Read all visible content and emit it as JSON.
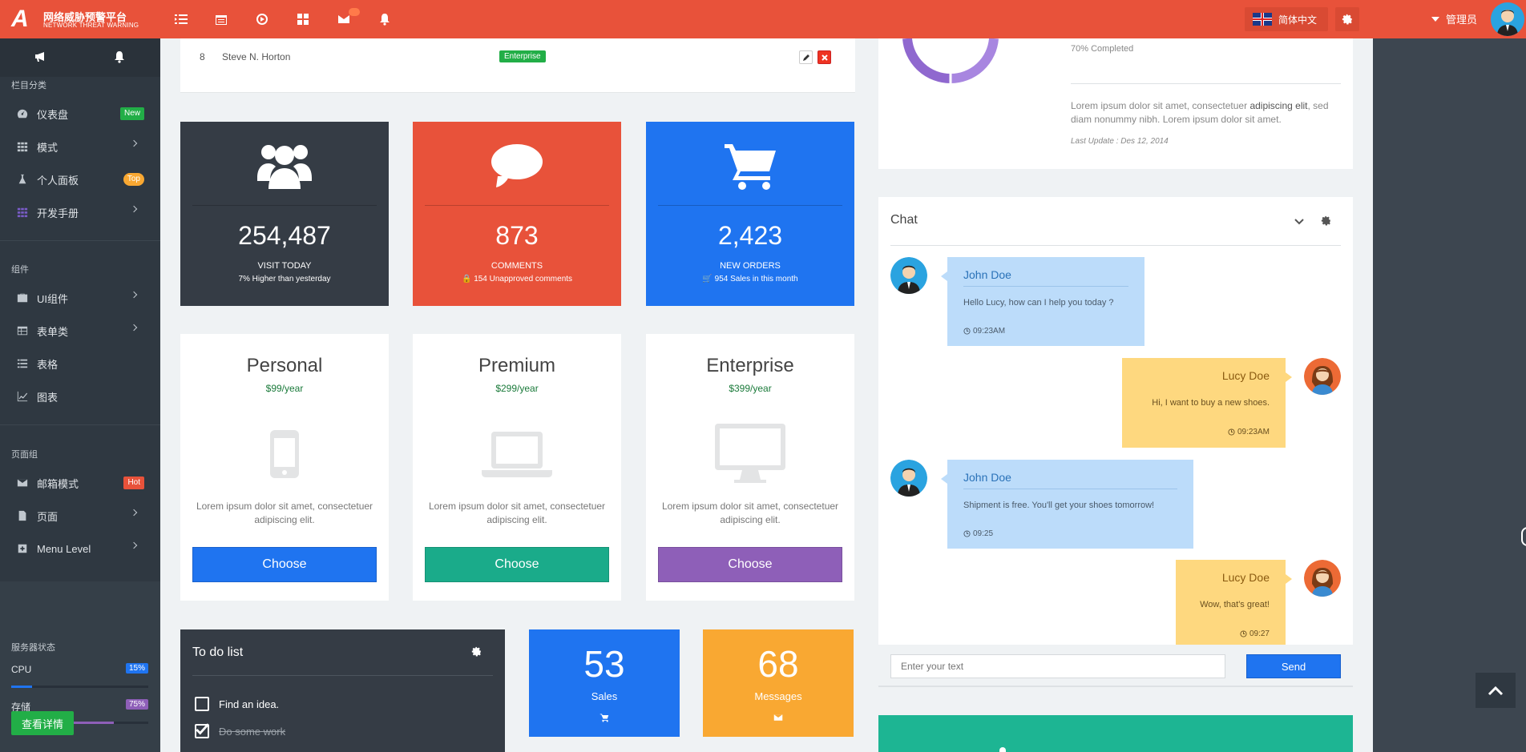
{
  "header": {
    "logo_letter": "A",
    "title": "网络威胁预警平台",
    "subtitle": "NETWORK THREAT WARNING",
    "language": "简体中文",
    "user": "管理员"
  },
  "sidebar": {
    "section_1": "栏目分类",
    "items_1": [
      {
        "label": "仪表盘",
        "badge": "New"
      },
      {
        "label": "模式"
      },
      {
        "label": "个人面板",
        "badge": "Top"
      },
      {
        "label": "开发手册"
      }
    ],
    "section_2": "组件",
    "items_2": [
      {
        "label": "UI组件"
      },
      {
        "label": "表单类"
      },
      {
        "label": "表格"
      },
      {
        "label": "图表"
      }
    ],
    "section_3": "页面组",
    "items_3": [
      {
        "label": "邮箱模式",
        "badge": "Hot"
      },
      {
        "label": "页面"
      },
      {
        "label": "Menu Level"
      }
    ],
    "status_title": "服务器状态",
    "cpu_label": "CPU",
    "cpu_value": "15%",
    "storage_label": "存储",
    "storage_value": "75%",
    "detail_button": "查看详情"
  },
  "table_row": {
    "num": "8",
    "name": "Steve N. Horton",
    "plan": "Enterprise"
  },
  "stat_cards": [
    {
      "value": "254,487",
      "label": "VISIT TODAY",
      "sub": "7% Higher than yesterday",
      "color": "#353c45"
    },
    {
      "value": "873",
      "label": "COMMENTS",
      "sub": "154 Unapproved comments",
      "color": "#e8523a"
    },
    {
      "value": "2,423",
      "label": "NEW ORDERS",
      "sub": "954 Sales in this month",
      "color": "#1f74f0"
    }
  ],
  "pricing": [
    {
      "title": "Personal",
      "price": "$99/year",
      "desc": "Lorem ipsum dolor sit amet, consectetuer adipiscing elit.",
      "button": "Choose",
      "color": "#1f74f0",
      "icon": "phone-icon"
    },
    {
      "title": "Premium",
      "price": "$299/year",
      "desc": "Lorem ipsum dolor sit amet, consectetuer adipiscing elit.",
      "button": "Choose",
      "color": "#1aab8a",
      "icon": "laptop-icon"
    },
    {
      "title": "Enterprise",
      "price": "$399/year",
      "desc": "Lorem ipsum dolor sit amet, consectetuer adipiscing elit.",
      "button": "Choose",
      "color": "#8e5fb8",
      "icon": "desktop-icon"
    }
  ],
  "todo": {
    "title": "To do list",
    "items": [
      {
        "label": "Find an idea.",
        "done": false
      },
      {
        "label": "Do some work",
        "done": true
      }
    ]
  },
  "mini_cards": [
    {
      "value": "53",
      "label": "Sales",
      "color": "#1f74f0",
      "icon": "cart-icon"
    },
    {
      "value": "68",
      "label": "Messages",
      "color": "#f9a832",
      "icon": "envelope-icon"
    }
  ],
  "progress": {
    "completed_text": "70% Completed",
    "desc_1": "Lorem ipsum dolor sit amet, consectetuer ",
    "desc_bold": "adipiscing elit",
    "desc_2": ", sed diam nonummy nibh. Lorem ipsum dolor sit amet.",
    "updated": "Last Update : Des 12, 2014"
  },
  "chat": {
    "title": "Chat",
    "messages": [
      {
        "name": "John Doe",
        "text": "Hello Lucy, how can I help you today ?",
        "time": "09:23AM",
        "side": "left"
      },
      {
        "name": "Lucy Doe",
        "text": "Hi, I want to buy a new shoes.",
        "time": "09:23AM",
        "side": "right"
      },
      {
        "name": "John Doe",
        "text": "Shipment is free. You'll get your shoes tomorrow!",
        "time": "09:25",
        "side": "left"
      },
      {
        "name": "Lucy Doe",
        "text": "Wow, that's great!",
        "time": "09:27",
        "side": "right"
      }
    ],
    "input_placeholder": "Enter your text",
    "send_label": "Send"
  }
}
